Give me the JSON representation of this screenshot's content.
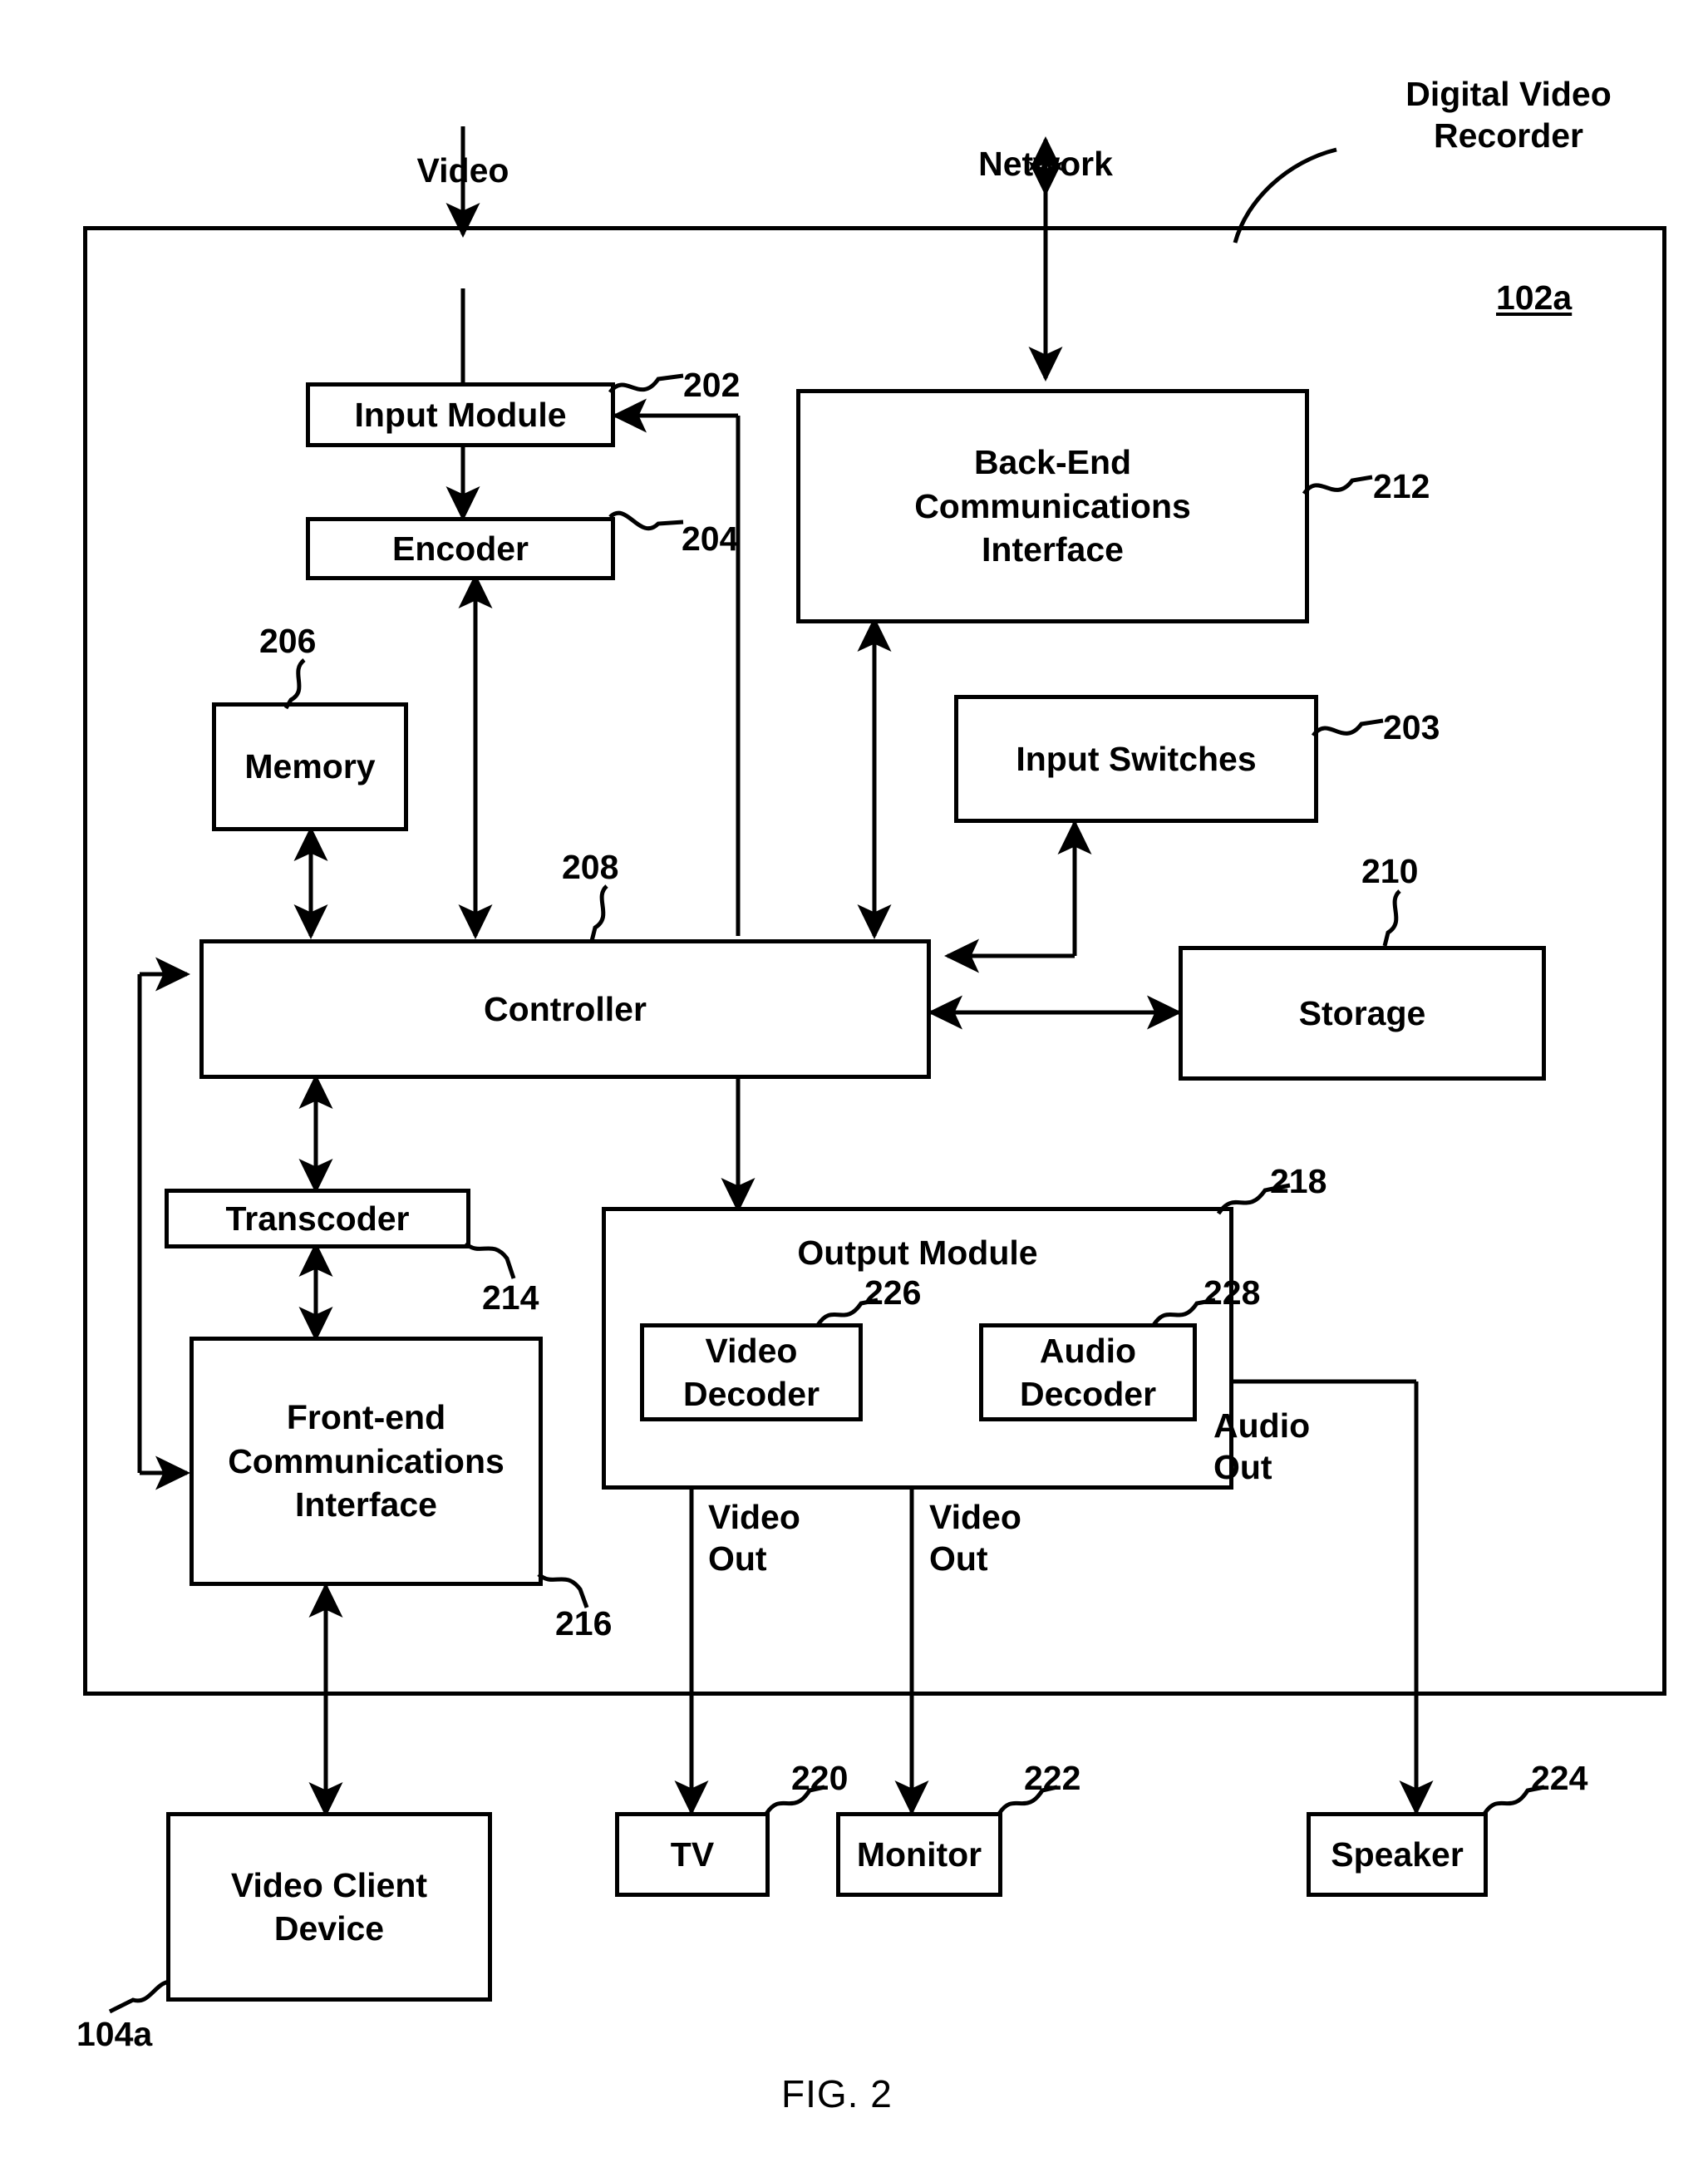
{
  "figure": {
    "caption": "FIG. 2",
    "outer_label": "Digital  Video\nRecorder",
    "outer_ref": "102a",
    "client_ref": "104a"
  },
  "signals": {
    "video_in": "Video",
    "network": "Network",
    "video_out_1": "Video\nOut",
    "video_out_2": "Video\nOut",
    "audio_out": "Audio\nOut"
  },
  "blocks": [
    {
      "id": "input_module",
      "label": "Input Module",
      "ref": "202"
    },
    {
      "id": "encoder",
      "label": "Encoder",
      "ref": "204"
    },
    {
      "id": "memory",
      "label": "Memory",
      "ref": "206"
    },
    {
      "id": "controller",
      "label": "Controller",
      "ref": "208"
    },
    {
      "id": "storage",
      "label": "Storage",
      "ref": "210"
    },
    {
      "id": "backend",
      "label": "Back-End\nCommunications\nInterface",
      "ref": "212"
    },
    {
      "id": "input_switches",
      "label": "Input Switches",
      "ref": "203"
    },
    {
      "id": "transcoder",
      "label": "Transcoder",
      "ref": "214"
    },
    {
      "id": "frontend",
      "label": "Front-end\nCommunications\nInterface",
      "ref": "216"
    },
    {
      "id": "output_module",
      "label": "Output Module",
      "ref": "218"
    },
    {
      "id": "video_decoder",
      "label": "Video\nDecoder",
      "ref": "226"
    },
    {
      "id": "audio_decoder",
      "label": "Audio\nDecoder",
      "ref": "228"
    },
    {
      "id": "tv",
      "label": "TV",
      "ref": "220"
    },
    {
      "id": "monitor",
      "label": "Monitor",
      "ref": "222"
    },
    {
      "id": "speaker",
      "label": "Speaker",
      "ref": "224"
    },
    {
      "id": "client",
      "label": "Video Client\nDevice",
      "ref": "104a"
    }
  ],
  "colors": {
    "ink": "#000000",
    "paper": "#ffffff"
  }
}
